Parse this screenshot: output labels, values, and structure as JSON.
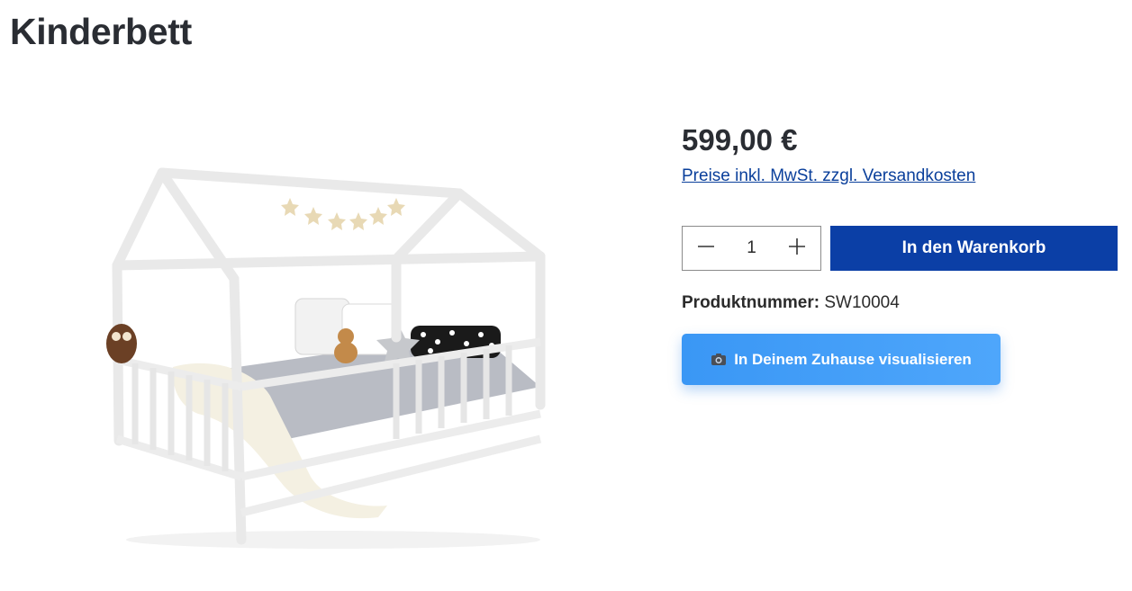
{
  "product": {
    "title": "Kinderbett",
    "image_alt": "Weißes Hausbett für Kinder mit Kissen, Kuscheltieren und Sternengirlande",
    "price": "599,00 €",
    "tax_note": "Preise inkl. MwSt. zzgl. Versandkosten",
    "quantity": "1",
    "add_to_cart_label": "In den Warenkorb",
    "sku_label": "Produktnummer:",
    "sku_value": "SW10004",
    "ar_button_label": "In Deinem Zuhause visualisieren"
  },
  "icons": {
    "decrease": "minus-icon",
    "increase": "plus-icon",
    "ar": "camera-icon"
  },
  "colors": {
    "primary": "#0b3fa6",
    "link": "#0a3f9b",
    "ar_button": "#3a97f5",
    "text": "#2a2d33"
  }
}
